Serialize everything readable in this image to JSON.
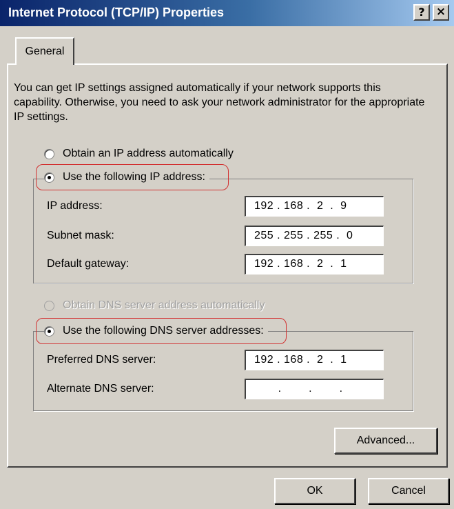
{
  "window": {
    "title": "Internet Protocol (TCP/IP) Properties",
    "help_label": "?",
    "close_label": "×"
  },
  "tabs": [
    {
      "label": "General"
    }
  ],
  "intro_text": "You can get IP settings assigned automatically if your network supports this capability. Otherwise, you need to ask your network administrator for the appropriate IP settings.",
  "ip": {
    "auto_label": "Obtain an IP address automatically",
    "manual_label": "Use the following IP address:",
    "fields": [
      {
        "label": "IP address:",
        "value": "192 . 168 .  2  .  9"
      },
      {
        "label": "Subnet mask:",
        "value": "255 . 255 . 255 .  0"
      },
      {
        "label": "Default gateway:",
        "value": "192 . 168 .  2  .  1"
      }
    ]
  },
  "dns": {
    "auto_label": "Obtain DNS server address automatically",
    "manual_label": "Use the following DNS server addresses:",
    "fields": [
      {
        "label": "Preferred DNS server:",
        "value": "192 . 168 .  2  .  1"
      },
      {
        "label": "Alternate DNS server:",
        "value": "       .        .        ."
      }
    ]
  },
  "buttons": {
    "advanced": "Advanced...",
    "ok": "OK",
    "cancel": "Cancel"
  },
  "colors": {
    "face": "#d4d0c8",
    "title_start": "#0a246a",
    "title_end": "#a6caf0",
    "highlight": "#d23030"
  }
}
